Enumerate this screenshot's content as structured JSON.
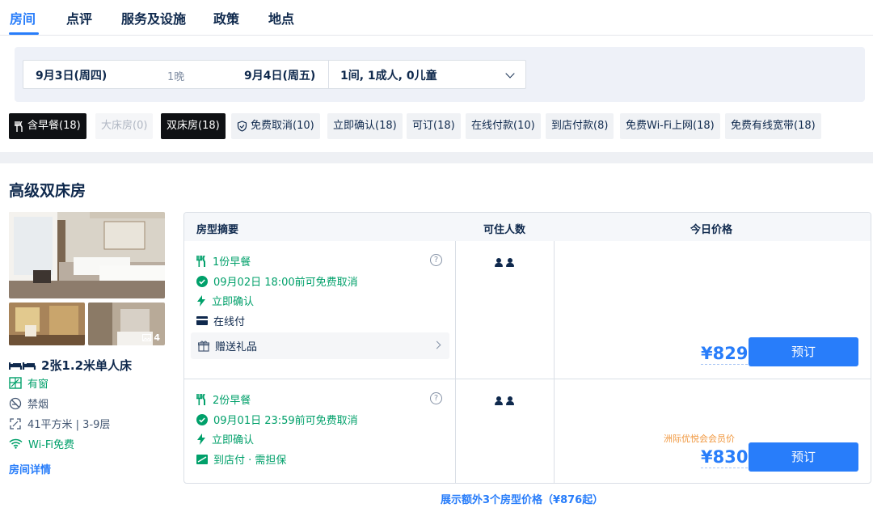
{
  "tabs": [
    "房间",
    "点评",
    "服务及设施",
    "政策",
    "地点"
  ],
  "search": {
    "checkin": "9月3日(周四)",
    "nights": "1晚",
    "checkout": "9月4日(周五)",
    "guests": "1间, 1成人, 0儿童"
  },
  "filters": [
    {
      "label": "含早餐(18)",
      "state": "selected",
      "icon": "fork-knife-icon"
    },
    {
      "label": "大床房(0)",
      "state": "disabled"
    },
    {
      "label": "双床房(18)",
      "state": "selected"
    },
    {
      "label": "免费取消(10)",
      "state": "normal",
      "icon": "shield-check-icon"
    },
    {
      "label": "立即确认(18)",
      "state": "normal"
    },
    {
      "label": "可订(18)",
      "state": "normal"
    },
    {
      "label": "在线付款(10)",
      "state": "normal"
    },
    {
      "label": "到店付款(8)",
      "state": "normal"
    },
    {
      "label": "免费Wi-Fi上网(18)",
      "state": "normal"
    },
    {
      "label": "免费有线宽带(18)",
      "state": "normal"
    }
  ],
  "room": {
    "title": "高级双床房",
    "photo_count": "4",
    "bed": "2张1.2米单人床",
    "window": "有窗",
    "smoking": "禁烟",
    "size": "41平方米 | 3-9层",
    "wifi": "Wi-Fi免费",
    "details_link": "房间详情"
  },
  "table": {
    "headers": {
      "summary": "房型摘要",
      "occupancy": "可住人数",
      "price": "今日价格"
    },
    "rates": [
      {
        "breakfast": "1份早餐",
        "cancel": "09月02日 18:00前可免费取消",
        "confirm": "立即确认",
        "payment": "在线付",
        "gift": "赠送礼品",
        "price": "¥829",
        "book": "预订"
      },
      {
        "breakfast": "2份早餐",
        "cancel": "09月01日 23:59前可免费取消",
        "confirm": "立即确认",
        "payment": "到店付 · 需担保",
        "member_label": "洲际优悦会会员价",
        "price": "¥830",
        "book": "预订"
      }
    ],
    "help_glyph": "?"
  },
  "more_link": "展示额外3个房型价格（¥876起）",
  "colors": {
    "accent": "#287dfa",
    "green": "#00a06a",
    "dark": "#0f294d",
    "member": "#f0963c"
  }
}
